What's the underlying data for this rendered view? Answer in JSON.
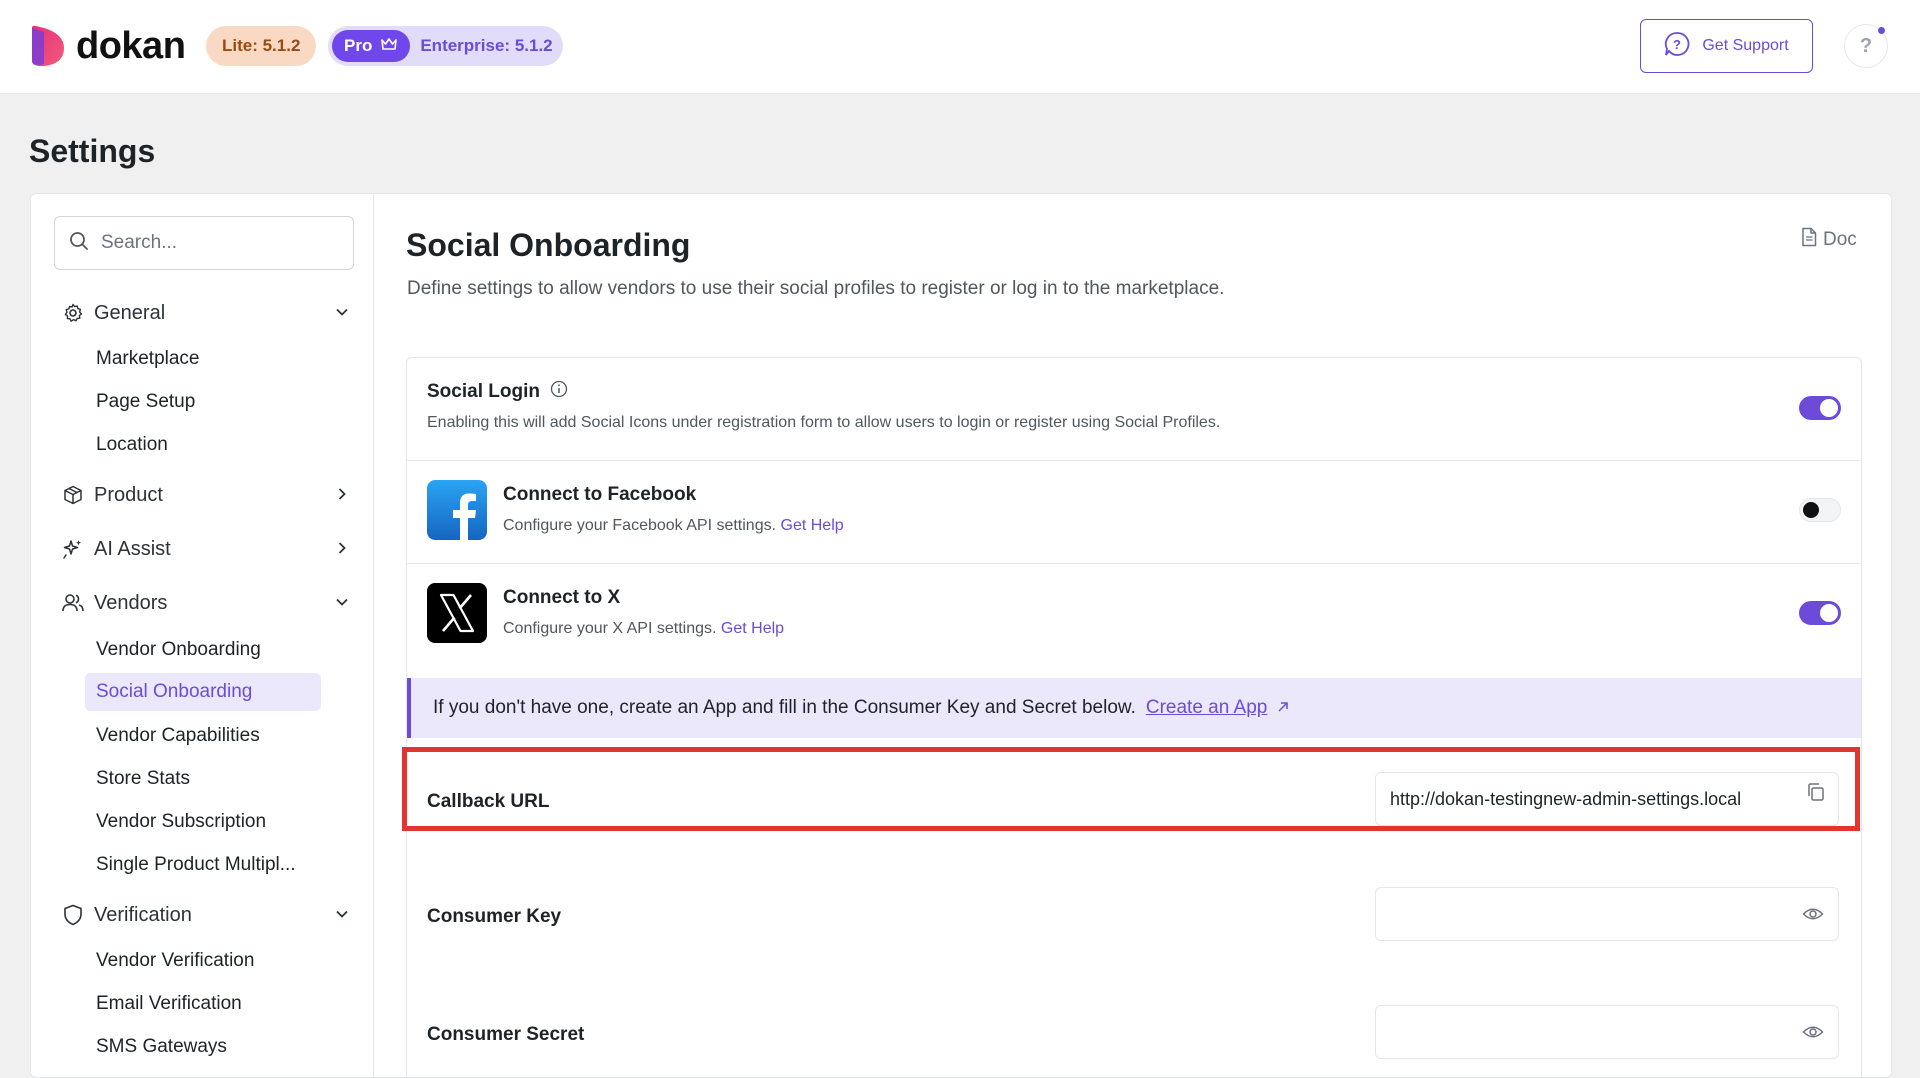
{
  "header": {
    "logo_text": "dokan",
    "lite_badge": "Lite: 5.1.2",
    "pro_label": "Pro",
    "enterprise_badge": "Enterprise: 5.1.2",
    "support_label": "Get Support",
    "help_label": "?"
  },
  "page": {
    "title": "Settings"
  },
  "sidebar": {
    "search_placeholder": "Search...",
    "general": {
      "label": "General",
      "items": [
        "Marketplace",
        "Page Setup",
        "Location"
      ]
    },
    "product": {
      "label": "Product"
    },
    "ai_assist": {
      "label": "AI Assist"
    },
    "vendors": {
      "label": "Vendors",
      "items": [
        "Vendor Onboarding",
        "Social Onboarding",
        "Vendor Capabilities",
        "Store Stats",
        "Vendor Subscription",
        "Single Product Multipl..."
      ]
    },
    "verification": {
      "label": "Verification",
      "items": [
        "Vendor Verification",
        "Email Verification",
        "SMS Gateways"
      ]
    }
  },
  "main": {
    "title": "Social Onboarding",
    "description": "Define settings to allow vendors to use their social profiles to register or log in to the marketplace.",
    "doc_label": "Doc",
    "social_login": {
      "label": "Social Login",
      "description": "Enabling this will add Social Icons under registration form to allow users to login or register using Social Profiles.",
      "enabled": true
    },
    "facebook": {
      "label": "Connect to Facebook",
      "description": "Configure your Facebook API settings.",
      "help_link": "Get Help",
      "enabled": false
    },
    "x": {
      "label": "Connect to X",
      "description": "Configure your X API settings.",
      "help_link": "Get Help",
      "enabled": true
    },
    "notice": {
      "text": "If you don't have one, create an App and fill in the Consumer Key and Secret below.",
      "link": "Create an App"
    },
    "callback_url": {
      "label": "Callback URL",
      "value": "http://dokan-testingnew-admin-settings.local"
    },
    "consumer_key": {
      "label": "Consumer Key",
      "value": ""
    },
    "consumer_secret": {
      "label": "Consumer Secret",
      "value": ""
    }
  },
  "colors": {
    "accent": "#6b4bd8",
    "highlight": "#e3342f"
  }
}
